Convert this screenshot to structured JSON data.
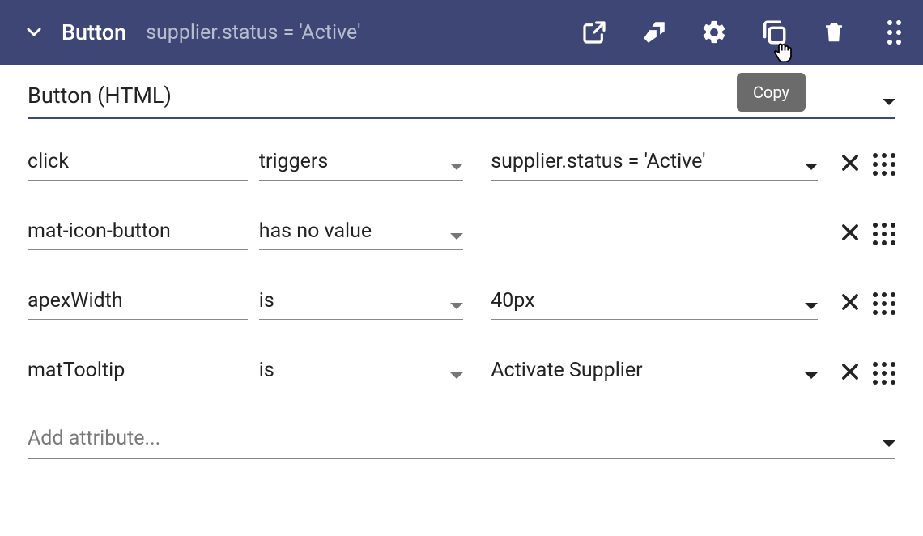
{
  "header": {
    "title": "Button",
    "subtitle": "supplier.status = 'Active'"
  },
  "tooltip": "Copy",
  "component": {
    "label": "Button (HTML)"
  },
  "attributes": [
    {
      "name": "click",
      "op": "triggers",
      "value": "supplier.status = 'Active'",
      "hasValue": true
    },
    {
      "name": "mat-icon-button",
      "op": "has no value",
      "value": "",
      "hasValue": false
    },
    {
      "name": "apexWidth",
      "op": "is",
      "value": "40px",
      "hasValue": true
    },
    {
      "name": "matTooltip",
      "op": "is",
      "value": "Activate Supplier",
      "hasValue": true
    }
  ],
  "addPlaceholder": "Add attribute..."
}
